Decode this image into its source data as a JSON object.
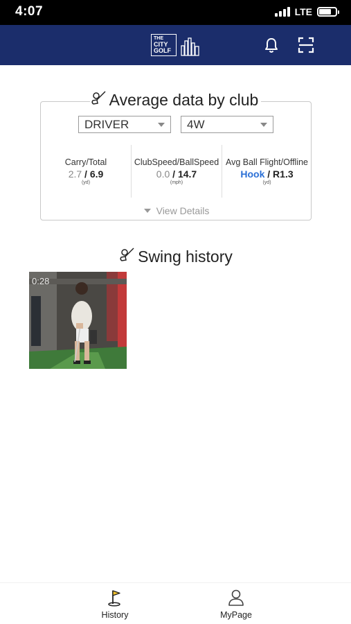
{
  "status_bar": {
    "time": "4:07",
    "network": "LTE",
    "battery_level": 0.75
  },
  "header": {
    "logo_text": [
      "THE",
      "CITY",
      "GOLF"
    ],
    "icons": [
      "bell-icon",
      "scan-icon"
    ]
  },
  "average_data": {
    "title": "Average data by club",
    "club_select_1": "DRIVER",
    "club_select_2": "4W",
    "stats": [
      {
        "label": "Carry/Total",
        "value_1": "2.7",
        "value_2": "6.9",
        "unit": "(yd)"
      },
      {
        "label": "ClubSpeed/BallSpeed",
        "value_1": "0.0",
        "value_2": "14.7",
        "unit": "(mph)"
      },
      {
        "label": "Avg Ball Flight/Offline",
        "value_1": "Hook",
        "value_2": "R1.3",
        "unit": "(yd)"
      }
    ],
    "separator": " / ",
    "view_details": "View Details"
  },
  "swing_history": {
    "title": "Swing history",
    "thumbnail_overlay": "0:28"
  },
  "bottom_nav": {
    "items": [
      {
        "label": "History",
        "icon": "flag-icon"
      },
      {
        "label": "MyPage",
        "icon": "person-icon"
      }
    ]
  }
}
